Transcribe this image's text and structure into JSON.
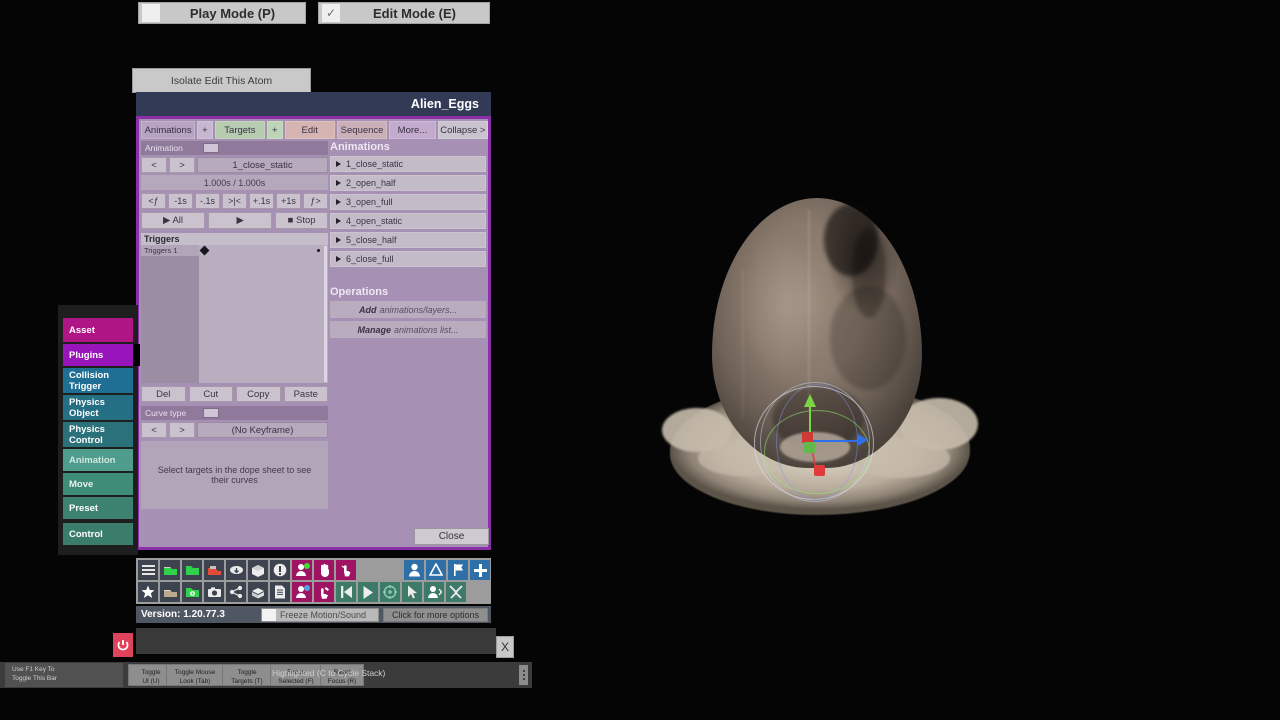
{
  "window": {
    "isolate_button": "Isolate Edit This Atom",
    "title": "Alien_Eggs",
    "close_label": "Close"
  },
  "tabs": [
    {
      "key": "animations",
      "label": "Animations"
    },
    {
      "key": "animations_plus",
      "label": "+"
    },
    {
      "key": "targets",
      "label": "Targets"
    },
    {
      "key": "targets_plus",
      "label": "+"
    },
    {
      "key": "edit",
      "label": "Edit"
    },
    {
      "key": "sequence",
      "label": "Sequence"
    },
    {
      "key": "more",
      "label": "More..."
    },
    {
      "key": "collapse",
      "label": "Collapse >"
    }
  ],
  "animation_panel": {
    "animation_label": "Animation",
    "prev_label": "<",
    "next_label": ">",
    "current_animation": "1_close_static",
    "time_readout": "1.000s / 1.000s",
    "step_buttons": [
      "<ƒ",
      "-1s",
      "-.1s",
      ">|<",
      "+.1s",
      "+1s",
      "ƒ>"
    ],
    "play_all_label": "▶ All",
    "play_label": "▶",
    "stop_label": "■ Stop"
  },
  "triggers": {
    "header": "Triggers",
    "track_label": "Triggers 1"
  },
  "edit_buttons": [
    "Del",
    "Cut",
    "Copy",
    "Paste"
  ],
  "curve": {
    "label": "Curve type",
    "prev_label": "<",
    "next_label": ">",
    "value": "(No Keyframe)",
    "hint": "Select targets in the dope sheet to see their curves"
  },
  "animations_list": {
    "header": "Animations",
    "items": [
      "1_close_static",
      "2_open_half",
      "3_open_full",
      "4_open_static",
      "5_close_half",
      "6_close_full"
    ]
  },
  "operations": {
    "header": "Operations",
    "items": [
      {
        "bold": "Add",
        "rest": "animations/layers..."
      },
      {
        "bold": "Manage",
        "rest": "animations list..."
      }
    ]
  },
  "sidebar": {
    "items": [
      {
        "label": "Asset",
        "color": "#b01585",
        "text": "#ffffff",
        "selected": false
      },
      {
        "label": "Plugins",
        "color": "#9a14bb",
        "text": "#ffffff",
        "selected": true
      },
      {
        "label": "Collision Trigger",
        "color": "#1f6e94",
        "text": "#ffffff",
        "selected": false
      },
      {
        "label": "Physics Object",
        "color": "#246f84",
        "text": "#ffffff",
        "selected": false
      },
      {
        "label": "Physics Control",
        "color": "#2a7179",
        "text": "#ffffff",
        "selected": false
      },
      {
        "label": "Animation",
        "color": "#4d9c8c",
        "text": "#cfe8e0",
        "selected": false
      },
      {
        "label": "Move",
        "color": "#3f8c78",
        "text": "#e6f2ee",
        "selected": false
      },
      {
        "label": "Preset",
        "color": "#3d8270",
        "text": "#ffffff",
        "selected": false
      },
      {
        "label": "Control",
        "color": "#3b7d6b",
        "text": "#ffffff",
        "selected": false
      }
    ]
  },
  "toolbar": {
    "row1": [
      {
        "name": "menu-icon",
        "bg": "#3d4450"
      },
      {
        "name": "load-scene-icon",
        "bg": "#3d4450"
      },
      {
        "name": "folder-icon",
        "bg": "#3d4450"
      },
      {
        "name": "save-icon",
        "bg": "#3d4450"
      },
      {
        "name": "cloud-icon",
        "bg": "#3d4450"
      },
      {
        "name": "package-icon",
        "bg": "#3d4450"
      },
      {
        "name": "alert-icon",
        "bg": "#3d4450"
      },
      {
        "name": "add-person-icon",
        "bg": "#9e1463"
      },
      {
        "name": "hand-icon",
        "bg": "#9e1463"
      },
      {
        "name": "touch-icon",
        "bg": "#9e1463"
      },
      {
        "name": "person-icon",
        "bg": "#2f6fa8"
      },
      {
        "name": "unity-icon",
        "bg": "#2f6fa8"
      },
      {
        "name": "flag-icon",
        "bg": "#2f6fa8"
      },
      {
        "name": "plus-icon",
        "bg": "#2f6fa8"
      }
    ],
    "row2": [
      {
        "name": "star-icon",
        "bg": "#3d4450"
      },
      {
        "name": "scene-load-icon",
        "bg": "#3d4450"
      },
      {
        "name": "folder-settings-icon",
        "bg": "#3d4450"
      },
      {
        "name": "screenshot-icon",
        "bg": "#3d4450"
      },
      {
        "name": "node-graph-icon",
        "bg": "#3d4450"
      },
      {
        "name": "box-open-icon",
        "bg": "#3d4450"
      },
      {
        "name": "document-icon",
        "bg": "#3d4450"
      },
      {
        "name": "remove-person-icon",
        "bg": "#9e1463"
      },
      {
        "name": "wrench-hand-icon",
        "bg": "#9e1463"
      },
      {
        "name": "skip-back-icon",
        "bg": "#3d7a67"
      },
      {
        "name": "play-icon",
        "bg": "#3d7a67"
      },
      {
        "name": "target-icon",
        "bg": "#3d7a67"
      },
      {
        "name": "cursor-icon",
        "bg": "#3d7a67"
      },
      {
        "name": "person-move-icon",
        "bg": "#3d7a67"
      },
      {
        "name": "tools-icon",
        "bg": "#3d7a67"
      }
    ]
  },
  "status": {
    "version": "Version: 1.20.77.3",
    "freeze_label": "Freeze Motion/Sound",
    "more_options": "Click for more options"
  },
  "modes": {
    "play_label": "Play Mode (P)",
    "edit_label": "Edit Mode (E)",
    "edit_checked": "✓",
    "close_x": "X"
  },
  "helpbar": {
    "hint_line1": "Use F1 Key To",
    "hint_line2": "Toggle This Bar",
    "buttons": [
      {
        "line1": "Toggle",
        "line2": "UI (U)"
      },
      {
        "line1": "Toggle Mouse",
        "line2": "Look (Tab)"
      },
      {
        "line1": "Toggle",
        "line2": "Targets (T)"
      },
      {
        "line1": "Focus",
        "line2": "Selected (F)"
      },
      {
        "line1": "Reset",
        "line2": "Focus (R)"
      }
    ],
    "highlight_text": "Highlighted (C to Cycle Stack)"
  },
  "viewport": {
    "model_name": "alien-egg-model",
    "gizmo": {
      "x_axis_color": "#2f6fe8",
      "y_axis_color": "#7ad643",
      "z_axis_color": "#e03a3a"
    }
  }
}
